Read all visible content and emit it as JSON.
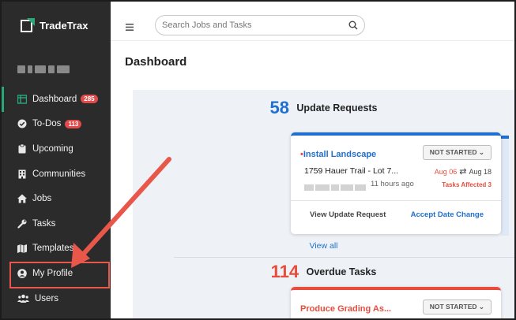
{
  "app": {
    "name": "TradeTrax",
    "brand_color": "#2aa87a"
  },
  "sidebar": {
    "items": [
      {
        "label": "Dashboard",
        "icon": "dashboard-icon",
        "badge": "285",
        "active": true
      },
      {
        "label": "To-Dos",
        "icon": "check-circle-icon",
        "badge": "113"
      },
      {
        "label": "Upcoming",
        "icon": "clipboard-icon"
      },
      {
        "label": "Communities",
        "icon": "building-icon"
      },
      {
        "label": "Jobs",
        "icon": "home-icon"
      },
      {
        "label": "Tasks",
        "icon": "wrench-icon"
      },
      {
        "label": "Templates",
        "icon": "map-icon"
      },
      {
        "label": "My Profile",
        "icon": "user-circle-icon"
      },
      {
        "label": "Users",
        "icon": "users-icon"
      }
    ]
  },
  "header": {
    "search_placeholder": "Search Jobs and Tasks"
  },
  "main": {
    "title": "Dashboard",
    "update_requests": {
      "count": "58",
      "label": "Update Requests",
      "card": {
        "task": "Install Landscape",
        "status": "NOT STARTED",
        "address": "1759 Hauer Trail - Lot 7...",
        "old_date": "Aug 06",
        "new_date": "Aug 18",
        "ago": "11 hours ago",
        "tasks_affected": "Tasks Affected 3",
        "btn_view": "View Update Request",
        "btn_accept": "Accept Date Change"
      },
      "view_all": "View all"
    },
    "overdue_tasks": {
      "count": "114",
      "label": "Overdue Tasks",
      "card": {
        "task": "Produce Grading As...",
        "status": "NOT STARTED"
      }
    }
  },
  "colors": {
    "accent_blue": "#1e6fd0",
    "alert_red": "#e74c3c",
    "annotation": "#e8574a"
  }
}
